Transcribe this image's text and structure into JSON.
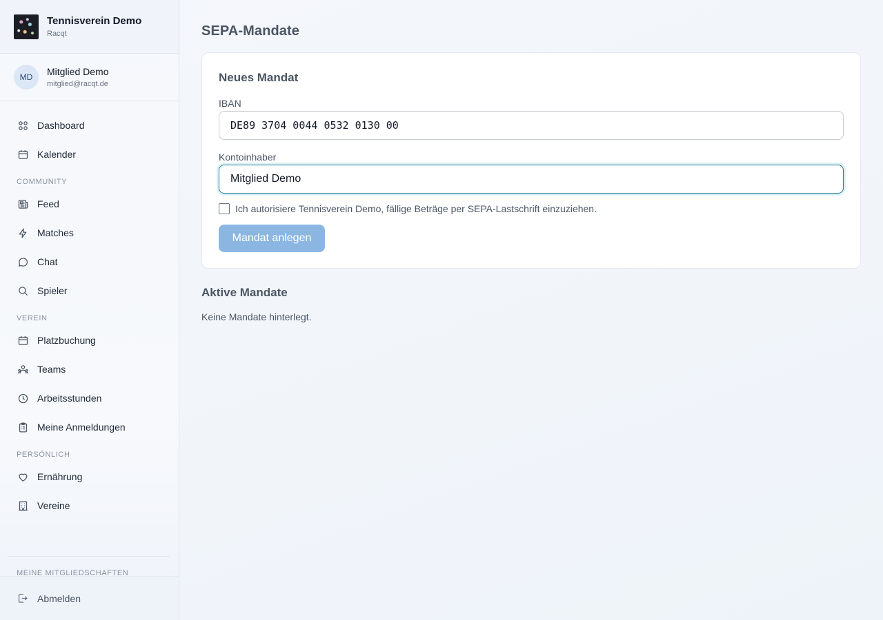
{
  "brand": {
    "title": "Tennisverein Demo",
    "subtitle": "Racqt"
  },
  "user": {
    "initials": "MD",
    "name": "Mitglied Demo",
    "email": "mitglied@racqt.de"
  },
  "nav": {
    "top": [
      {
        "label": "Dashboard",
        "icon": "dashboard-icon"
      },
      {
        "label": "Kalender",
        "icon": "calendar-icon"
      }
    ],
    "community_label": "COMMUNITY",
    "community": [
      {
        "label": "Feed",
        "icon": "newspaper-icon"
      },
      {
        "label": "Matches",
        "icon": "lightning-icon"
      },
      {
        "label": "Chat",
        "icon": "chat-bubble-icon"
      },
      {
        "label": "Spieler",
        "icon": "search-icon"
      }
    ],
    "verein_label": "VEREIN",
    "verein": [
      {
        "label": "Platzbuchung",
        "icon": "calendar-icon"
      },
      {
        "label": "Teams",
        "icon": "team-icon"
      },
      {
        "label": "Arbeitsstunden",
        "icon": "clock-icon"
      },
      {
        "label": "Meine Anmeldungen",
        "icon": "clipboard-icon"
      }
    ],
    "persoenlich_label": "PERSÖNLICH",
    "persoenlich": [
      {
        "label": "Ernährung",
        "icon": "heart-icon"
      },
      {
        "label": "Vereine",
        "icon": "building-icon"
      }
    ],
    "memberships_label": "MEINE MITGLIEDSCHAFTEN",
    "logout_label": "Abmelden"
  },
  "main": {
    "page_title": "SEPA-Mandate",
    "form": {
      "title": "Neues Mandat",
      "iban_label": "IBAN",
      "iban_value": "DE89 3704 0044 0532 0130 00",
      "holder_label": "Kontoinhaber",
      "holder_value": "Mitglied Demo",
      "consent_text": "Ich autorisiere Tennisverein Demo, fällige Beträge per SEPA-Lastschrift einzuziehen.",
      "submit_label": "Mandat anlegen"
    },
    "active_title": "Aktive Mandate",
    "empty_text": "Keine Mandate hinterlegt."
  },
  "colors": {
    "accent_focus": "#2a7c8e",
    "button_disabled": "#8cb6e2",
    "avatar_bg": "#dbe7f6"
  }
}
